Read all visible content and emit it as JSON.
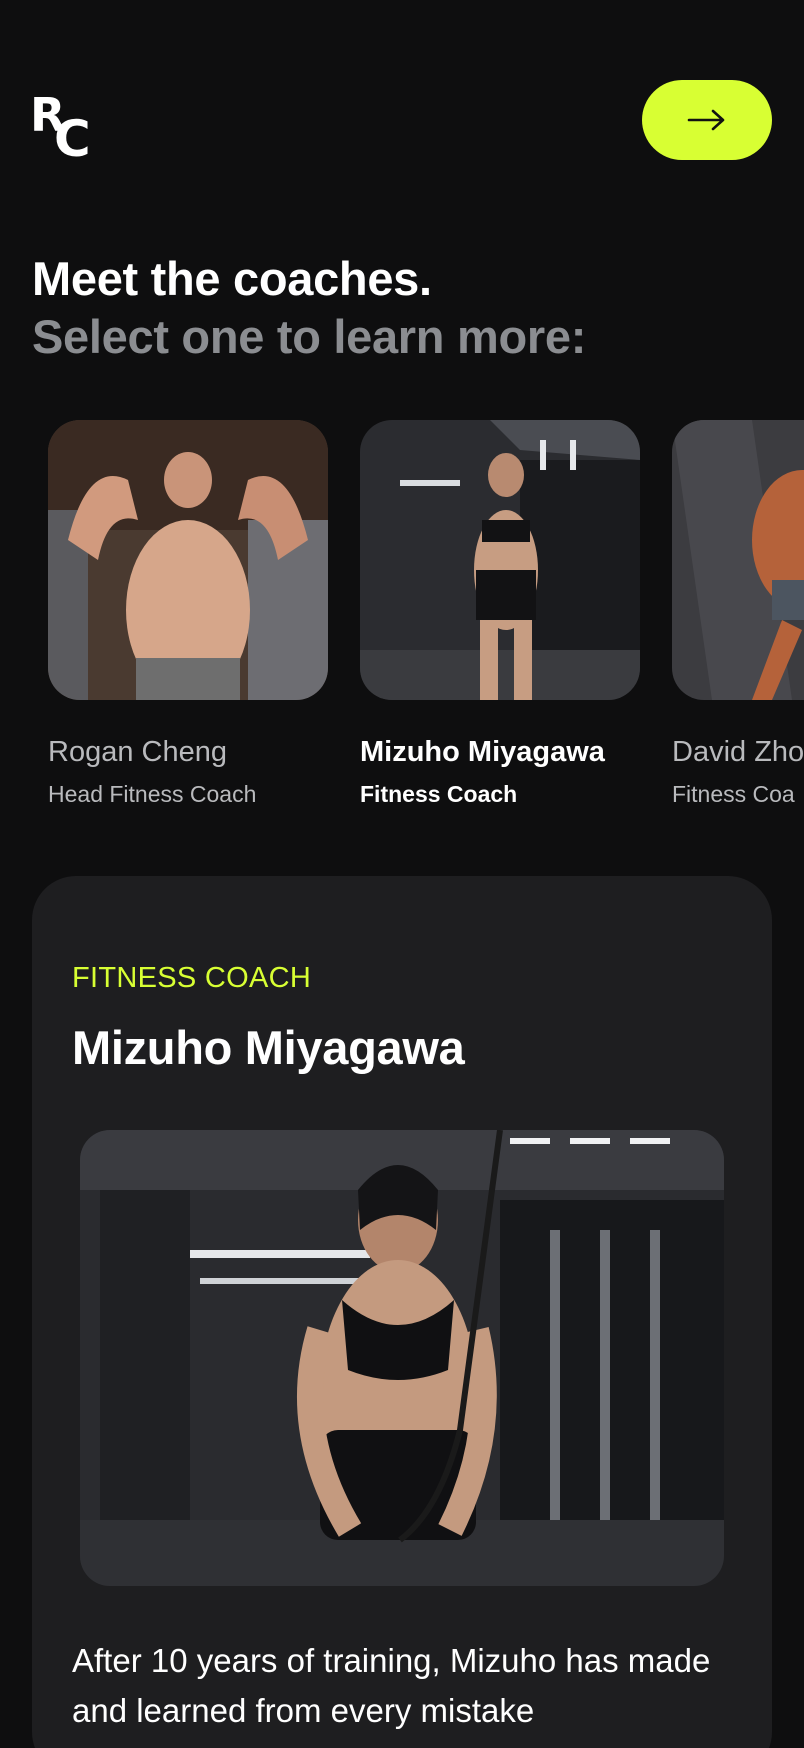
{
  "brand": {
    "logo_text_r": "R",
    "logo_text_c": "C"
  },
  "header": {
    "next_icon": "arrow-right-icon",
    "accent": "#d8ff33"
  },
  "intro": {
    "title": "Meet the coaches.",
    "subtitle": "Select one to learn more:"
  },
  "coaches": [
    {
      "name": "Rogan Cheng",
      "role": "Head Fitness Coach",
      "selected": false
    },
    {
      "name": "Mizuho Miyagawa",
      "role": "Fitness Coach",
      "selected": true
    },
    {
      "name": "David Zho",
      "role": "Fitness Coa",
      "selected": false
    }
  ],
  "detail": {
    "eyebrow": "FITNESS COACH",
    "name": "Mizuho Miyagawa",
    "bio": "After 10 years of training, Mizuho has made and learned from every mistake"
  },
  "colors": {
    "background": "#0e0e0f",
    "card": "#1e1e20",
    "accent": "#d8ff33",
    "muted": "#8b8d91"
  }
}
